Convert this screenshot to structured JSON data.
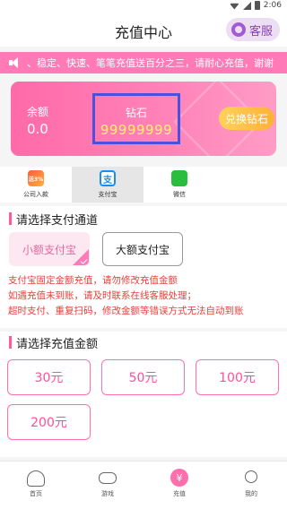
{
  "status_bar": {
    "time": "2:06"
  },
  "header": {
    "title": "充值中心",
    "service_label": "客服"
  },
  "marquee": {
    "text": "、稳定、快速、笔笔充值送百分之三，请耐心充值，谢谢"
  },
  "card": {
    "balance_label": "余额",
    "balance_value": "0.0",
    "diamond_label": "钻石",
    "diamond_value": "99999999",
    "exchange_label": "兑换钻石"
  },
  "pay_tabs": [
    {
      "label": "公司入款",
      "icon": "company-icon",
      "badge": "送3%"
    },
    {
      "label": "支付宝",
      "icon": "alipay-icon",
      "badge": "支"
    },
    {
      "label": "微信",
      "icon": "wechat-icon",
      "badge": ""
    }
  ],
  "channel_section": {
    "title": "请选择支付通道",
    "options": [
      "小额支付宝",
      "大额支付宝"
    ],
    "selected": "小额支付宝"
  },
  "notice": [
    "支付宝固定金额充值，请勿修改充值金额",
    "如遇充值未到账，请及时联系在线客服处理；",
    "超时支付、重复扫码，修改金额等错误方式无法自动到账"
  ],
  "amount_section": {
    "title": "请选择充值金额",
    "amounts": [
      "30元",
      "50元",
      "100元",
      "200元"
    ]
  },
  "tabbar": [
    {
      "label": "首页",
      "icon": "home-icon"
    },
    {
      "label": "游戏",
      "icon": "gamepad-icon"
    },
    {
      "label": "充值",
      "icon": "recharge-icon",
      "glyph": "¥"
    },
    {
      "label": "我的",
      "icon": "user-icon"
    }
  ],
  "colors": {
    "accent": "#ff6fae",
    "highlight_box": "#4a50e0",
    "notice": "#e8403a"
  }
}
